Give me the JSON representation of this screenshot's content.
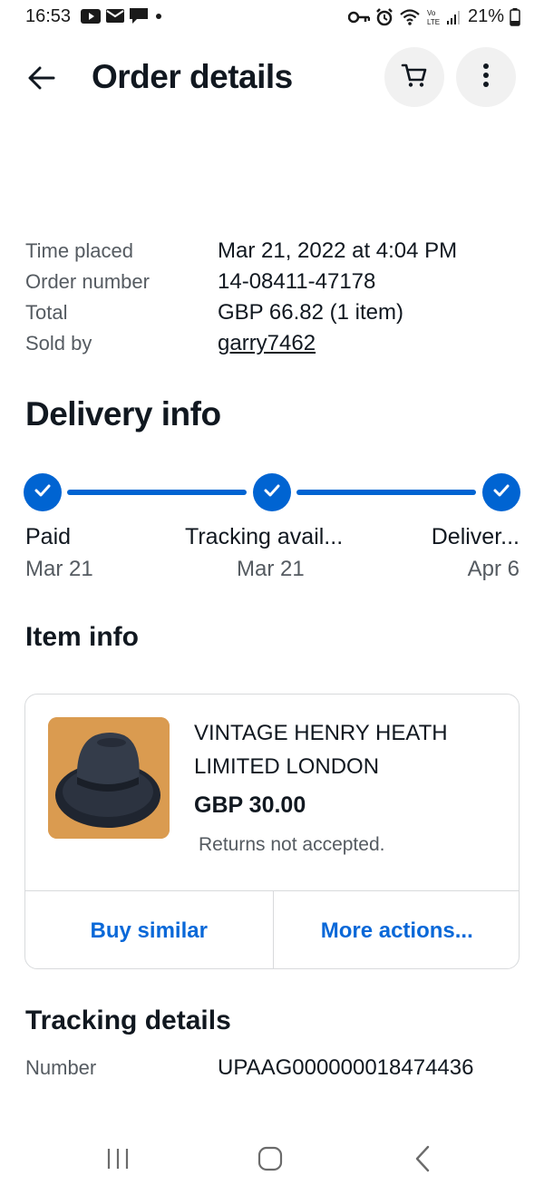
{
  "status_bar": {
    "time": "16:53",
    "battery": "21%",
    "icons": [
      "youtube-icon",
      "mail-icon",
      "chat-icon",
      "dot-icon",
      "key-icon",
      "alarm-icon",
      "wifi-icon",
      "volte-icon",
      "signal-icon",
      "battery-icon"
    ]
  },
  "header": {
    "title": "Order details",
    "back_icon": "arrow-left-icon",
    "cart_icon": "cart-icon",
    "more_icon": "more-vertical-icon"
  },
  "order_summary": {
    "rows": [
      {
        "label": "Time placed",
        "value": "Mar 21, 2022 at 4:04 PM"
      },
      {
        "label": "Order number",
        "value": "14-08411-47178"
      },
      {
        "label": "Total",
        "value": "GBP 66.82 (1 item)"
      },
      {
        "label": "Sold by",
        "value": "garry7462"
      }
    ]
  },
  "delivery": {
    "title": "Delivery info",
    "steps": [
      {
        "label": "Paid",
        "date": "Mar 21"
      },
      {
        "label": "Tracking avail...",
        "date": "Mar 21"
      },
      {
        "label": "Deliver...",
        "date": "Apr 6"
      }
    ],
    "accent": "#0064d2"
  },
  "item_info": {
    "title": "Item info",
    "name": "VINTAGE HENRY HEATH LIMITED LONDON",
    "price": "GBP 30.00",
    "returns": "Returns not accepted.",
    "actions": {
      "buy_similar": "Buy similar",
      "more_actions": "More actions..."
    },
    "link_color": "#0968d8"
  },
  "tracking": {
    "title": "Tracking details",
    "number_label": "Number",
    "number_value": "UPAAG000000018474436"
  },
  "nav_bar": {
    "icons": [
      "recent-apps-icon",
      "home-icon",
      "back-icon"
    ]
  }
}
